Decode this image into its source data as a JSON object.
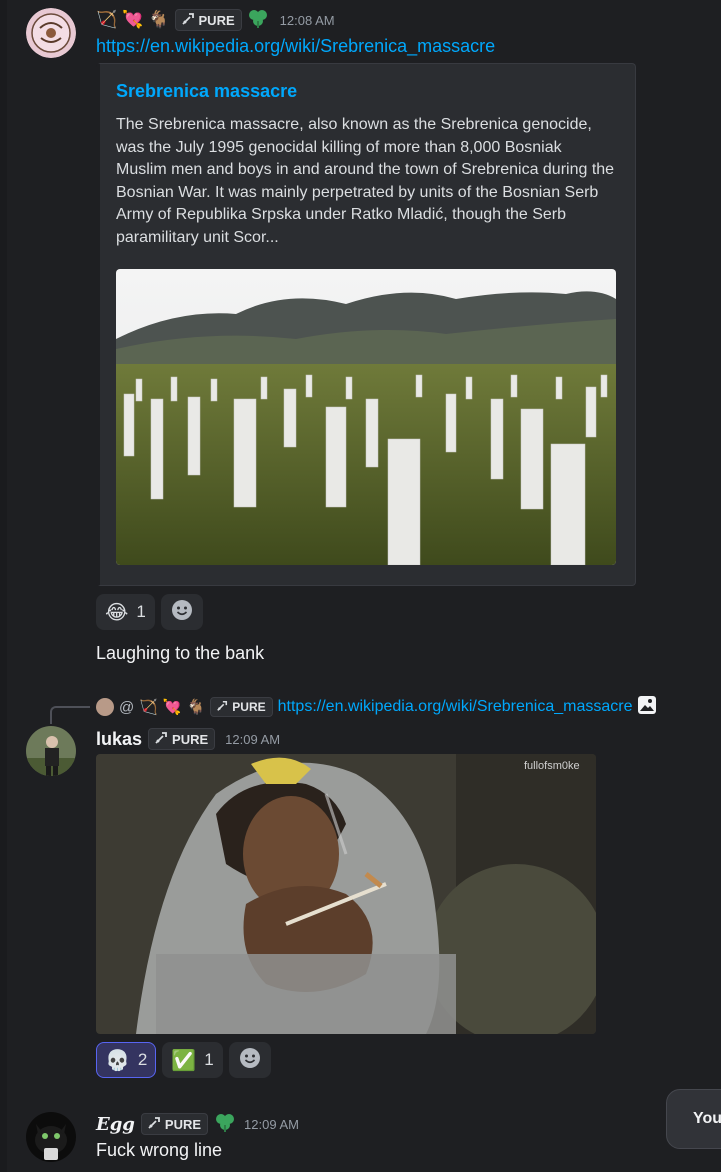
{
  "colors": {
    "background": "#1e1f22",
    "link": "#00a8fc",
    "embed_bg": "#2b2d31",
    "reaction_active_border": "#5865f2"
  },
  "messages": [
    {
      "tags": [
        "bow-and-arrow-emoji",
        "sparkling-heart-emoji",
        "goat-emoji"
      ],
      "role_badge": "PURE",
      "time": "12:08 AM",
      "link": "https://en.wikipedia.org/wiki/Srebrenica_massacre",
      "embed": {
        "title": "Srebrenica massacre",
        "description": "The Srebrenica massacre, also known as the Srebrenica genocide, was the July 1995 genocidal killing of more than 8,000 Bosniak Muslim men and boys in and around the town of Srebrenica during the Bosnian War. It was mainly perpetrated by units of the Bosnian Serb Army of Republika Srpska under Ratko Mladić, though the Serb paramilitary unit Scor..."
      },
      "reactions": [
        {
          "emoji": "😂",
          "count": "1"
        }
      ],
      "followup_text": "Laughing to the bank"
    },
    {
      "reply": {
        "mention": "@",
        "badge": "PURE",
        "link": "https://en.wikipedia.org/wiki/Srebrenica_massacre"
      },
      "username": "lukas",
      "role_badge": "PURE",
      "time": "12:09 AM",
      "gif_watermark": "fullofsm0ke",
      "reactions": [
        {
          "emoji": "💀",
          "count": "2",
          "active": true
        },
        {
          "emoji": "✅",
          "count": "1",
          "active": false
        }
      ]
    },
    {
      "username": "Egg",
      "role_badge": "PURE",
      "time": "12:09 AM",
      "text": "Fuck wrong line"
    }
  ],
  "toast": {
    "text": "You'"
  }
}
